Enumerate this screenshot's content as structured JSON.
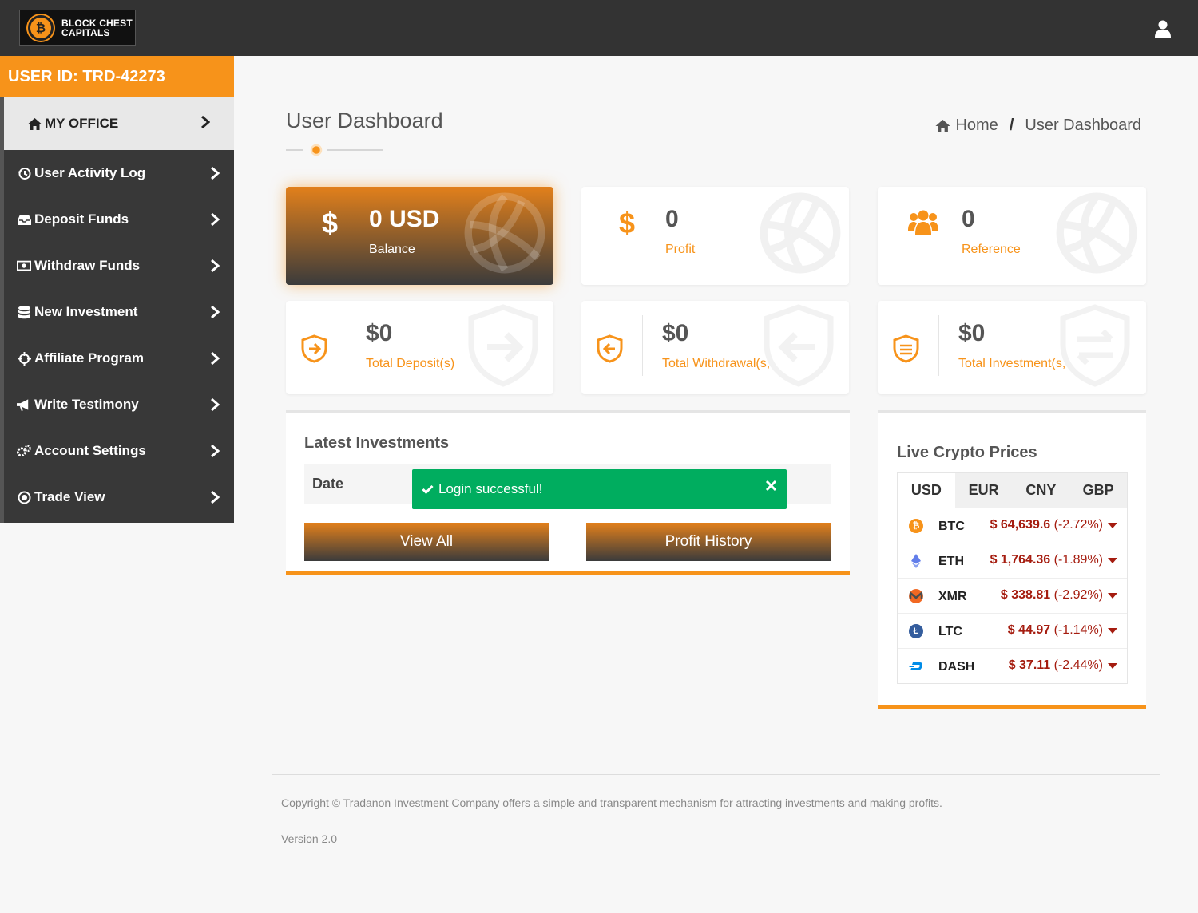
{
  "header": {
    "logo_icon": "bitcoin-icon",
    "logo_line1": "BLOCK CHEST",
    "logo_line2": "CAPITALS",
    "user_icon": "user-icon"
  },
  "sidebar": {
    "user_id": "USER ID: TRD-42273",
    "office": {
      "label": "MY OFFICE",
      "icon": "home-icon"
    },
    "items": [
      {
        "label": "User Activity Log",
        "icon": "history-icon"
      },
      {
        "label": "Deposit Funds",
        "icon": "inbox-icon"
      },
      {
        "label": "Withdraw Funds",
        "icon": "money-icon"
      },
      {
        "label": "New Investment",
        "icon": "database-icon"
      },
      {
        "label": "Affiliate Program",
        "icon": "crosshair-icon"
      },
      {
        "label": "Write Testimony",
        "icon": "bullhorn-icon"
      },
      {
        "label": "Account Settings",
        "icon": "gears-icon"
      },
      {
        "label": "Trade View",
        "icon": "dot-circle-icon"
      }
    ]
  },
  "page": {
    "title": "User Dashboard",
    "breadcrumb_home": "Home",
    "breadcrumb_sep": "/",
    "breadcrumb_current": "User Dashboard"
  },
  "cards": {
    "balance": {
      "value": "0 USD",
      "label": "Balance",
      "icon": "dollar-icon"
    },
    "profit": {
      "value": "0",
      "label": "Profit",
      "icon": "dollar-icon"
    },
    "reference": {
      "value": "0",
      "label": "Reference",
      "icon": "users-icon"
    },
    "deposit": {
      "value": "$0",
      "label": "Total Deposit(s)",
      "icon": "shield-arrow-right-icon"
    },
    "withdrawal": {
      "value": "$0",
      "label": "Total Withdrawal(s,",
      "icon": "shield-arrow-left-icon"
    },
    "investment": {
      "value": "$0",
      "label": "Total Investment(s,",
      "icon": "shield-exchange-icon"
    }
  },
  "investments": {
    "title": "Latest Investments",
    "column_date": "Date",
    "view_all": "View All",
    "profit_history": "Profit History"
  },
  "toast": {
    "message": "Login successful!",
    "icon": "check-icon",
    "close_icon": "close-icon",
    "color": "#00ad5f"
  },
  "crypto": {
    "title": "Live Crypto Prices",
    "tabs": [
      "USD",
      "EUR",
      "CNY",
      "GBP"
    ],
    "active_tab": "USD",
    "rows": [
      {
        "symbol": "BTC",
        "price": "$ 64,639.6",
        "change": "(-2.72%)",
        "icon": "bitcoin-icon",
        "color": "#f7931a"
      },
      {
        "symbol": "ETH",
        "price": "$ 1,764.36",
        "change": "(-1.89%)",
        "icon": "ethereum-icon",
        "color": "#627eea"
      },
      {
        "symbol": "XMR",
        "price": "$ 338.81",
        "change": "(-2.92%)",
        "icon": "monero-icon",
        "color": "#f26822"
      },
      {
        "symbol": "LTC",
        "price": "$ 44.97",
        "change": "(-1.14%)",
        "icon": "litecoin-icon",
        "color": "#345d9d"
      },
      {
        "symbol": "DASH",
        "price": "$ 37.11",
        "change": "(-2.44%)",
        "icon": "dash-icon",
        "color": "#008ce7"
      }
    ]
  },
  "footer": {
    "copyright": "Copyright © Tradanon Investment Company offers a simple and transparent mechanism for attracting investments and making profits.",
    "version": "Version 2.0"
  },
  "colors": {
    "accent": "#f7931a",
    "topbar": "#333333",
    "sidebar": "#383838",
    "negative": "#a51c0f"
  }
}
